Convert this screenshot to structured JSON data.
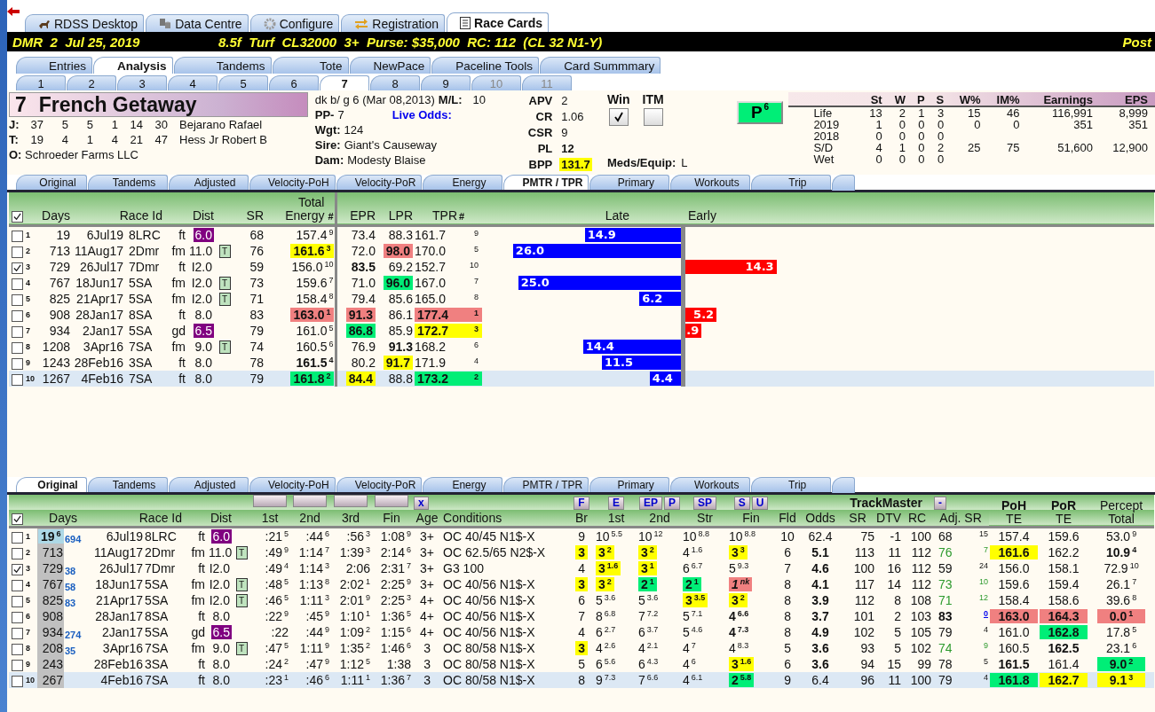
{
  "top_tabs": [
    {
      "label": "RDSS Desktop",
      "kind": "horse",
      "selected": false
    },
    {
      "label": "Data Centre",
      "kind": "data",
      "selected": false
    },
    {
      "label": "Configure",
      "kind": "gear",
      "selected": false
    },
    {
      "label": "Registration",
      "kind": "arrows",
      "selected": false
    },
    {
      "label": "Race Cards",
      "kind": "card",
      "selected": true
    }
  ],
  "race_bar": {
    "left": "DMR  2  Jul 25, 2019",
    "middle": "8.5f  Turf  CL32000  3+  Purse: $35,000  RC: 112  (CL 32 N1-Y)",
    "right": "Post"
  },
  "main_tabs": [
    {
      "label": "Entries",
      "selected": false
    },
    {
      "label": "Analysis",
      "selected": true
    },
    {
      "label": "Tandems",
      "selected": false
    },
    {
      "label": "Tote",
      "selected": false
    },
    {
      "label": "NewPace",
      "selected": false
    },
    {
      "label": "Paceline Tools",
      "selected": false
    },
    {
      "label": "Card Summmary",
      "selected": false
    }
  ],
  "horse_tabs": [
    {
      "label": "1",
      "selected": false,
      "disabled": false
    },
    {
      "label": "2",
      "selected": false,
      "disabled": false
    },
    {
      "label": "3",
      "selected": false,
      "disabled": false
    },
    {
      "label": "4",
      "selected": false,
      "disabled": false
    },
    {
      "label": "5",
      "selected": false,
      "disabled": false
    },
    {
      "label": "6",
      "selected": false,
      "disabled": false
    },
    {
      "label": "7",
      "selected": true,
      "disabled": false
    },
    {
      "label": "8",
      "selected": false,
      "disabled": false
    },
    {
      "label": "9",
      "selected": false,
      "disabled": false
    },
    {
      "label": "10",
      "selected": false,
      "disabled": true
    },
    {
      "label": "11",
      "selected": false,
      "disabled": true
    }
  ],
  "horse": {
    "number": "7",
    "name": "French Getaway",
    "people": [
      {
        "label": "J:",
        "stats": [
          "37",
          "5",
          "5",
          "1",
          "14",
          "30"
        ],
        "name": "Bejarano Rafael"
      },
      {
        "label": "T:",
        "stats": [
          "19",
          "4",
          "1",
          "4",
          "21",
          "47"
        ],
        "name": "Hess Jr Robert B"
      }
    ],
    "owner_label": "O:",
    "owner": "Schroeder Farms LLC",
    "breeding": "dk b/ g 6 (Mar 08,2013)",
    "ml_label": "M/L:",
    "ml": "10",
    "pp_label": "PP-",
    "pp": "7",
    "live_odds": "Live Odds:",
    "details": [
      {
        "label": "Wgt:",
        "value": "124"
      },
      {
        "label": "Sire:",
        "value": "Giant's Causeway"
      },
      {
        "label": "Dam:",
        "value": "Modesty Blaise"
      }
    ],
    "ratings": [
      {
        "label": "APV",
        "value": "2",
        "bold": false
      },
      {
        "label": "CR",
        "value": "1.06",
        "bold": false
      },
      {
        "label": "CSR",
        "value": "9",
        "bold": false
      },
      {
        "label": "PL",
        "value": "12",
        "bold": true
      },
      {
        "label": "BPP",
        "value": "131.7",
        "bold": true,
        "color": "#ffff00"
      }
    ],
    "checks": [
      {
        "label": "Win",
        "checked": true
      },
      {
        "label": "ITM",
        "checked": false
      }
    ],
    "meds_label": "Meds/Equip:",
    "meds": "L",
    "p_button": {
      "label": "P",
      "sup": "6"
    },
    "stats": {
      "columns": [
        "St",
        "W",
        "P",
        "S",
        "W%",
        "IM%",
        "Earnings",
        "EPS"
      ],
      "rows": [
        {
          "label": "Life",
          "values": [
            "13",
            "2",
            "1",
            "3",
            "15",
            "46",
            "116,991",
            "8,999"
          ]
        },
        {
          "label": "2019",
          "values": [
            "1",
            "0",
            "0",
            "0",
            "0",
            "0",
            "351",
            "351"
          ]
        },
        {
          "label": "2018",
          "values": [
            "0",
            "0",
            "0",
            "0"
          ]
        },
        {
          "label": "S/D",
          "values": [
            "4",
            "1",
            "0",
            "2",
            "25",
            "75",
            "51,600",
            "12,900"
          ]
        },
        {
          "label": "Wet",
          "values": [
            "0",
            "0",
            "0",
            "0"
          ]
        }
      ]
    }
  },
  "upper": {
    "tabs": [
      {
        "label": "Original",
        "selected": false
      },
      {
        "label": "Tandems",
        "selected": false
      },
      {
        "label": "Adjusted",
        "selected": false
      },
      {
        "label": "Velocity-PoH",
        "selected": false
      },
      {
        "label": "Velocity-PoR",
        "selected": false
      },
      {
        "label": "Energy",
        "selected": false
      },
      {
        "label": "PMTR / TPR",
        "selected": true
      },
      {
        "label": "Primary",
        "selected": false
      },
      {
        "label": "Workouts",
        "selected": false
      },
      {
        "label": "Trip",
        "selected": false
      }
    ],
    "all_checked": true,
    "headers": {
      "days": "Days",
      "race_id": "Race Id",
      "dist": "Dist",
      "sr": "SR",
      "energy": "Total\nEnergy",
      "energy_rank": "#",
      "epr": "EPR",
      "lpr": "LPR",
      "tpr": "TPR",
      "tpr_rank": "#",
      "late": "Late",
      "early": "Early"
    },
    "rows": [
      {
        "num": "1",
        "checked": false,
        "selected": false,
        "days": "19",
        "date": "6Jul19",
        "track": "8LRC",
        "surface": "ft",
        "dist": {
          "text": "6.0",
          "color": "#800080"
        },
        "sr": "68",
        "energy": {
          "text": "157.4",
          "sup": "9"
        },
        "epr": "73.4",
        "lpr": "88.3",
        "tpr": {
          "text": "161.7",
          "sup": "9"
        },
        "pace": {
          "kind": "late",
          "value": "14.9",
          "level": 0.56
        }
      },
      {
        "num": "2",
        "checked": false,
        "selected": false,
        "days": "713",
        "date": "11Aug17",
        "track": "2Dmr",
        "surface": "fm",
        "dist": "11.0",
        "tag": "T",
        "sr": "76",
        "energy": {
          "text": "161.6",
          "sup": "3",
          "color": "#ffff00",
          "bold": true
        },
        "epr": "72.0",
        "lpr": {
          "text": "98.0",
          "color": "#f08080",
          "bold": true
        },
        "tpr": {
          "text": "170.0",
          "sup": "5"
        },
        "pace": {
          "kind": "late",
          "value": "26.0",
          "level": 0.98
        }
      },
      {
        "num": "3",
        "checked": true,
        "selected": false,
        "days": "729",
        "date": "26Jul17",
        "track": "7Dmr",
        "surface": "ft",
        "dist": "I2.0",
        "sr": "59",
        "energy": {
          "text": "156.0",
          "sup": "10"
        },
        "epr": {
          "text": "83.5",
          "bold": true
        },
        "lpr": "69.2",
        "tpr": {
          "text": "152.7",
          "sup": "10"
        },
        "pace": {
          "kind": "early",
          "value": "14.3",
          "level": 0.55
        }
      },
      {
        "num": "4",
        "checked": false,
        "selected": false,
        "days": "767",
        "date": "18Jun17",
        "track": "5SA",
        "surface": "fm",
        "dist": "I2.0",
        "tag": "T",
        "sr": "73",
        "energy": {
          "text": "159.6",
          "sup": "7"
        },
        "epr": "71.0",
        "lpr": {
          "text": "96.0",
          "color": "#00ee77",
          "bold": true
        },
        "tpr": {
          "text": "167.0",
          "sup": "7"
        },
        "pace": {
          "kind": "late",
          "value": "25.0",
          "level": 0.95
        }
      },
      {
        "num": "5",
        "checked": false,
        "selected": false,
        "days": "825",
        "date": "21Apr17",
        "track": "5SA",
        "surface": "fm",
        "dist": "I2.0",
        "tag": "T",
        "sr": "71",
        "energy": {
          "text": "158.4",
          "sup": "8"
        },
        "epr": "79.4",
        "lpr": "85.6",
        "tpr": {
          "text": "165.0",
          "sup": "8"
        },
        "pace": {
          "kind": "late",
          "value": "6.2",
          "level": 0.24
        }
      },
      {
        "num": "6",
        "checked": false,
        "selected": false,
        "days": "908",
        "date": "28Jan17",
        "track": "8SA",
        "surface": "ft",
        "dist": "8.0",
        "sr": "83",
        "energy": {
          "text": "163.0",
          "sup": "1",
          "color": "#f08080",
          "bold": true
        },
        "epr": {
          "text": "91.3",
          "color": "#f08080",
          "bold": true
        },
        "lpr": "86.1",
        "tpr": {
          "text": "177.4",
          "sup": "1",
          "color": "#f08080",
          "bold": true
        },
        "pace": {
          "kind": "early",
          "value": "5.2",
          "level": 0.19
        }
      },
      {
        "num": "7",
        "checked": false,
        "selected": false,
        "days": "934",
        "date": "2Jan17",
        "track": "5SA",
        "surface": "gd",
        "dist": {
          "text": "6.5",
          "color": "#800080"
        },
        "sr": "79",
        "energy": {
          "text": "161.0",
          "sup": "5"
        },
        "epr": {
          "text": "86.8",
          "color": "#00ee77",
          "bold": true
        },
        "lpr": "85.9",
        "tpr": {
          "text": "172.7",
          "sup": "3",
          "color": "#ffff00",
          "bold": true
        },
        "pace": {
          "kind": "early",
          "value": ".9",
          "level": 0.1
        }
      },
      {
        "num": "8",
        "checked": false,
        "selected": false,
        "days": "1208",
        "date": "3Apr16",
        "track": "7SA",
        "surface": "fm",
        "dist": "9.0",
        "tag": "T",
        "sr": "74",
        "energy": {
          "text": "160.5",
          "sup": "6"
        },
        "epr": "76.9",
        "lpr": {
          "text": "91.3",
          "bold": true
        },
        "tpr": {
          "text": "168.2",
          "sup": "6"
        },
        "pace": {
          "kind": "late",
          "value": "14.4",
          "level": 0.57
        }
      },
      {
        "num": "9",
        "checked": false,
        "selected": false,
        "days": "1243",
        "date": "28Feb16",
        "track": "3SA",
        "surface": "ft",
        "dist": "8.0",
        "sr": "78",
        "energy": {
          "text": "161.5",
          "sup": "4",
          "bold": true
        },
        "epr": "80.2",
        "lpr": {
          "text": "91.7",
          "color": "#ffff00",
          "bold": true
        },
        "tpr": {
          "text": "171.9",
          "sup": "4"
        },
        "pace": {
          "kind": "late",
          "value": "11.5",
          "level": 0.46
        }
      },
      {
        "num": "10",
        "checked": false,
        "selected": true,
        "days": "1267",
        "date": "4Feb16",
        "track": "7SA",
        "surface": "ft",
        "dist": "8.0",
        "sr": "79",
        "energy": {
          "text": "161.8",
          "sup": "2",
          "color": "#00ee77",
          "bold": true
        },
        "epr": {
          "text": "84.4",
          "color": "#ffff00",
          "bold": true
        },
        "lpr": "88.8",
        "tpr": {
          "text": "173.2",
          "sup": "2",
          "color": "#00ee77",
          "bold": true
        },
        "pace": {
          "kind": "late",
          "value": "4.4",
          "level": 0.18
        }
      }
    ]
  },
  "lower": {
    "tabs": [
      {
        "label": "Original",
        "selected": true
      },
      {
        "label": "Tandems",
        "selected": false
      },
      {
        "label": "Adjusted",
        "selected": false
      },
      {
        "label": "Velocity-PoH",
        "selected": false
      },
      {
        "label": "Velocity-PoR",
        "selected": false
      },
      {
        "label": "Energy",
        "selected": false
      },
      {
        "label": "PMTR / TPR",
        "selected": false
      },
      {
        "label": "Primary",
        "selected": false
      },
      {
        "label": "Workouts",
        "selected": false
      },
      {
        "label": "Trip",
        "selected": false
      }
    ],
    "all_checked": true,
    "split_buttons": [
      {
        "kind": "blank"
      },
      {
        "kind": "blank"
      },
      {
        "kind": "blank"
      },
      {
        "kind": "blank"
      },
      {
        "kind": "label",
        "label": "x"
      }
    ],
    "call_buttons": [
      "F",
      "E",
      "EP",
      "P",
      "SP",
      "S",
      "U"
    ],
    "trackmaster": "TrackMaster",
    "adj_button": "-",
    "headers": [
      "Days",
      "Race Id",
      "Dist",
      "1st",
      "2nd",
      "3rd",
      "Fin",
      "Age",
      "Conditions",
      "Br",
      "1st",
      "2nd",
      "Str",
      "Fin",
      "Fld",
      "Odds",
      "SR",
      "DTV",
      "RC",
      "Adj. SR",
      "**PoH**\nTE",
      "**PoR**\nTE",
      "Percept\nTotal"
    ],
    "rows": [
      {
        "num": "1",
        "checked": false,
        "selected": false,
        "days": {
          "text": "19",
          "sup": "6",
          "bold": true,
          "color": "#add8e6"
        },
        "gap": "694",
        "date": "6Jul19",
        "track": "8LRC",
        "surface": "ft",
        "dist": {
          "text": "6.0",
          "color": "#800080"
        },
        "fractions": [
          {
            "text": ":21",
            "sup": "5"
          },
          {
            "text": ":44",
            "sup": "6"
          },
          {
            "text": ":56",
            "sup": "3"
          },
          {
            "text": "1:08",
            "sup": "9"
          }
        ],
        "age": "3+",
        "conditions": "OC 40/45 N1$-X",
        "br": "9",
        "calls": [
          {
            "text": "10",
            "sup": "5.5"
          },
          {
            "text": "10",
            "sup": "12"
          },
          {
            "text": "10",
            "sup": "8.8"
          },
          {
            "text": "10",
            "sup": "8.8"
          }
        ],
        "fld": "10",
        "odds": "62.4",
        "sr": "75",
        "dtv": "-1",
        "rc": "100",
        "adj_sr": {
          "text": "68",
          "sup": "15"
        },
        "poh": "157.4",
        "por": "159.6",
        "percept": {
          "text": "53.0",
          "sup": "9"
        }
      },
      {
        "num": "2",
        "checked": false,
        "selected": false,
        "days": "713",
        "date": "11Aug17",
        "track": "2Dmr",
        "surface": "fm",
        "dist": "11.0",
        "tag": "T",
        "fractions": [
          {
            "text": ":49",
            "sup": "9"
          },
          {
            "text": "1:14",
            "sup": "7"
          },
          {
            "text": "1:39",
            "sup": "3"
          },
          {
            "text": "2:14",
            "sup": "6"
          }
        ],
        "age": "3+",
        "conditions": "OC 62.5/65 N2$-X",
        "br": {
          "text": "3",
          "color": "#ffff00",
          "bold": true
        },
        "calls": [
          {
            "text": "3",
            "sup": "2",
            "color": "#ffff00",
            "bold": true
          },
          {
            "text": "3",
            "sup": "2",
            "color": "#ffff00",
            "bold": true
          },
          {
            "text": "4",
            "sup": "1.6"
          },
          {
            "text": "3",
            "sup": "3",
            "color": "#ffff00",
            "bold": true
          }
        ],
        "fld": "6",
        "odds": {
          "text": "5.1",
          "bold": true
        },
        "sr": "113",
        "dtv": "11",
        "rc": "112",
        "adj_sr": {
          "text": "76",
          "sup": "7",
          "tinted": true
        },
        "poh": {
          "text": "161.6",
          "color": "#ffff00",
          "bold": true
        },
        "por": "162.2",
        "percept": {
          "text": "10.9",
          "sup": "4",
          "bold": true
        }
      },
      {
        "num": "3",
        "checked": true,
        "selected": false,
        "days": "729",
        "gap": "38",
        "date": "26Jul17",
        "track": "7Dmr",
        "surface": "ft",
        "dist": "I2.0",
        "fractions": [
          {
            "text": ":49",
            "sup": "4"
          },
          {
            "text": "1:14",
            "sup": "3"
          },
          {
            "text": "2:06"
          },
          {
            "text": "2:31",
            "sup": "7"
          }
        ],
        "age": "3+",
        "conditions": "G3 100",
        "br": "4",
        "calls": [
          {
            "text": "3",
            "sup": "1.6",
            "color": "#ffff00",
            "bold": true
          },
          {
            "text": "3",
            "sup": "1",
            "color": "#ffff00",
            "bold": true
          },
          {
            "text": "6",
            "sup": "6.7"
          },
          {
            "text": "5",
            "sup": "9.3"
          }
        ],
        "fld": "7",
        "odds": {
          "text": "4.6",
          "bold": true
        },
        "sr": "100",
        "dtv": "16",
        "rc": "112",
        "adj_sr": {
          "text": "59",
          "sup": "24"
        },
        "poh": "156.0",
        "por": "158.1",
        "percept": {
          "text": "72.9",
          "sup": "10"
        }
      },
      {
        "num": "4",
        "checked": false,
        "selected": false,
        "days": "767",
        "gap": "58",
        "date": "18Jun17",
        "track": "5SA",
        "surface": "fm",
        "dist": "I2.0",
        "tag": "T",
        "fractions": [
          {
            "text": ":48",
            "sup": "5"
          },
          {
            "text": "1:13",
            "sup": "8"
          },
          {
            "text": "2:02",
            "sup": "1"
          },
          {
            "text": "2:25",
            "sup": "9"
          }
        ],
        "age": "3+",
        "conditions": "OC 40/56 N1$-X",
        "br": {
          "text": "3",
          "color": "#ffff00",
          "bold": true
        },
        "calls": [
          {
            "text": "3",
            "sup": "2",
            "color": "#ffff00",
            "bold": true
          },
          {
            "text": "2",
            "sup": "1",
            "color": "#00ee77",
            "bold": true
          },
          {
            "text": "2",
            "sup": "1",
            "color": "#00ee77",
            "bold": true
          },
          {
            "text": "1",
            "sup": "nk",
            "color": "#f08080",
            "bold": true,
            "italic": true
          }
        ],
        "fld": "8",
        "odds": {
          "text": "4.1",
          "bold": true
        },
        "sr": "117",
        "dtv": "14",
        "rc": "112",
        "adj_sr": {
          "text": "73",
          "sup": "10",
          "tinted": true
        },
        "poh": "159.6",
        "por": "159.4",
        "percept": {
          "text": "26.1",
          "sup": "7"
        }
      },
      {
        "num": "5",
        "checked": false,
        "selected": false,
        "days": "825",
        "gap": "83",
        "date": "21Apr17",
        "track": "5SA",
        "surface": "fm",
        "dist": "I2.0",
        "tag": "T",
        "fractions": [
          {
            "text": ":46",
            "sup": "5"
          },
          {
            "text": "1:11",
            "sup": "3"
          },
          {
            "text": "2:01",
            "sup": "9"
          },
          {
            "text": "2:25",
            "sup": "3"
          }
        ],
        "age": "4+",
        "conditions": "OC 40/56 N1$-X",
        "br": "6",
        "calls": [
          {
            "text": "5",
            "sup": "3.6"
          },
          {
            "text": "5",
            "sup": "3.6"
          },
          {
            "text": "3",
            "sup": "3.5",
            "color": "#ffff00",
            "bold": true
          },
          {
            "text": "3",
            "sup": "2",
            "color": "#ffff00",
            "bold": true
          }
        ],
        "fld": "8",
        "odds": {
          "text": "3.9",
          "bold": true
        },
        "sr": "112",
        "dtv": "8",
        "rc": "108",
        "adj_sr": {
          "text": "71",
          "sup": "12",
          "tinted": true
        },
        "poh": "158.4",
        "por": "158.6",
        "percept": {
          "text": "39.6",
          "sup": "8"
        }
      },
      {
        "num": "6",
        "checked": false,
        "selected": false,
        "days": "908",
        "date": "28Jan17",
        "track": "8SA",
        "surface": "ft",
        "dist": "8.0",
        "fractions": [
          {
            "text": ":22",
            "sup": "9"
          },
          {
            "text": ":45",
            "sup": "9"
          },
          {
            "text": "1:10",
            "sup": "1"
          },
          {
            "text": "1:36",
            "sup": "5"
          }
        ],
        "age": "4+",
        "conditions": "OC 40/56 N1$-X",
        "br": "7",
        "calls": [
          {
            "text": "8",
            "sup": "6.8"
          },
          {
            "text": "7",
            "sup": "7.2"
          },
          {
            "text": "5",
            "sup": "7.1"
          },
          {
            "text": "4",
            "sup": "6.6",
            "bold": true
          }
        ],
        "fld": "8",
        "odds": {
          "text": "3.7",
          "bold": true
        },
        "sr": "101",
        "dtv": "2",
        "rc": "103",
        "adj_sr": {
          "text": "83",
          "sup": "0",
          "bold": true,
          "link": true
        },
        "poh": {
          "text": "163.0",
          "color": "#f08080",
          "bold": true
        },
        "por": {
          "text": "164.3",
          "color": "#f08080",
          "bold": true
        },
        "percept": {
          "text": "0.0",
          "sup": "1",
          "color": "#f08080",
          "bold": true
        }
      },
      {
        "num": "7",
        "checked": false,
        "selected": false,
        "days": "934",
        "gap": "274",
        "date": "2Jan17",
        "track": "5SA",
        "surface": "gd",
        "dist": {
          "text": "6.5",
          "color": "#800080"
        },
        "fractions": [
          {
            "text": ":22"
          },
          {
            "text": ":44",
            "sup": "9"
          },
          {
            "text": "1:09",
            "sup": "2"
          },
          {
            "text": "1:15",
            "sup": "6"
          }
        ],
        "age": "4+",
        "conditions": "OC 40/56 N1$-X",
        "br": "4",
        "calls": [
          {
            "text": "6",
            "sup": "2.7"
          },
          {
            "text": "6",
            "sup": "3.7"
          },
          {
            "text": "5",
            "sup": "4.6"
          },
          {
            "text": "4",
            "sup": "7.3",
            "bold": true
          }
        ],
        "fld": "8",
        "odds": {
          "text": "4.9",
          "bold": true
        },
        "sr": "102",
        "dtv": "5",
        "rc": "105",
        "adj_sr": {
          "text": "79",
          "sup": "4"
        },
        "poh": "161.0",
        "por": {
          "text": "162.8",
          "color": "#00ee77",
          "bold": true
        },
        "percept": {
          "text": "17.8",
          "sup": "5"
        }
      },
      {
        "num": "8",
        "checked": false,
        "selected": false,
        "days": "208",
        "gap": "35",
        "date": "3Apr16",
        "track": "7SA",
        "surface": "fm",
        "dist": "9.0",
        "tag": "T",
        "fractions": [
          {
            "text": ":47",
            "sup": "5"
          },
          {
            "text": "1:11",
            "sup": "9"
          },
          {
            "text": "1:35",
            "sup": "2"
          },
          {
            "text": "1:46",
            "sup": "6"
          }
        ],
        "age": "3",
        "conditions": "OC 80/58 N1$-X",
        "br": {
          "text": "3",
          "color": "#ffff00",
          "bold": true
        },
        "calls": [
          {
            "text": "4",
            "sup": "2.6"
          },
          {
            "text": "4",
            "sup": "2.1"
          },
          {
            "text": "4",
            "sup": "7"
          },
          {
            "text": "4",
            "sup": "8.3"
          }
        ],
        "fld": "5",
        "odds": {
          "text": "3.6",
          "bold": true
        },
        "sr": "93",
        "dtv": "5",
        "rc": "102",
        "adj_sr": {
          "text": "74",
          "sup": "9",
          "tinted": true
        },
        "poh": "160.5",
        "por": {
          "text": "162.5",
          "bold": true
        },
        "percept": {
          "text": "23.1",
          "sup": "6"
        }
      },
      {
        "num": "9",
        "checked": false,
        "selected": false,
        "days": "243",
        "date": "28Feb16",
        "track": "3SA",
        "surface": "ft",
        "dist": "8.0",
        "fractions": [
          {
            "text": ":24",
            "sup": "2"
          },
          {
            "text": ":47",
            "sup": "9"
          },
          {
            "text": "1:12",
            "sup": "5"
          },
          {
            "text": "1:38"
          }
        ],
        "age": "3",
        "conditions": "OC 80/58 N1$-X",
        "br": "5",
        "calls": [
          {
            "text": "6",
            "sup": "5.6"
          },
          {
            "text": "6",
            "sup": "4.3"
          },
          {
            "text": "4",
            "sup": "6"
          },
          {
            "text": "3",
            "sup": "1.6",
            "color": "#ffff00",
            "bold": true
          }
        ],
        "fld": "6",
        "odds": {
          "text": "3.6",
          "bold": true
        },
        "sr": "94",
        "dtv": "15",
        "rc": "99",
        "adj_sr": {
          "text": "78",
          "sup": "5"
        },
        "poh": {
          "text": "161.5",
          "bold": true
        },
        "por": "161.4",
        "percept": {
          "text": "9.0",
          "sup": "2",
          "color": "#00ee77",
          "bold": true
        }
      },
      {
        "num": "10",
        "checked": false,
        "selected": true,
        "days": "267",
        "date": "4Feb16",
        "track": "7SA",
        "surface": "ft",
        "dist": "8.0",
        "fractions": [
          {
            "text": ":23",
            "sup": "1"
          },
          {
            "text": ":46",
            "sup": "6"
          },
          {
            "text": "1:11",
            "sup": "1"
          },
          {
            "text": "1:36",
            "sup": "7"
          }
        ],
        "age": "3",
        "conditions": "OC 80/58 N1$-X",
        "br": "8",
        "calls": [
          {
            "text": "9",
            "sup": "7.3"
          },
          {
            "text": "7",
            "sup": "6.6"
          },
          {
            "text": "4",
            "sup": "6.1"
          },
          {
            "text": "2",
            "sup": "5.8",
            "color": "#00ee77",
            "bold": true
          }
        ],
        "fld": "9",
        "odds": "6.4",
        "sr": "96",
        "dtv": "11",
        "rc": "100",
        "adj_sr": {
          "text": "79",
          "sup": "4"
        },
        "poh": {
          "text": "161.8",
          "color": "#00ee77",
          "bold": true
        },
        "por": {
          "text": "162.7",
          "color": "#ffff00",
          "bold": true
        },
        "percept": {
          "text": "9.1",
          "sup": "3",
          "color": "#ffff00",
          "bold": true
        }
      }
    ]
  }
}
